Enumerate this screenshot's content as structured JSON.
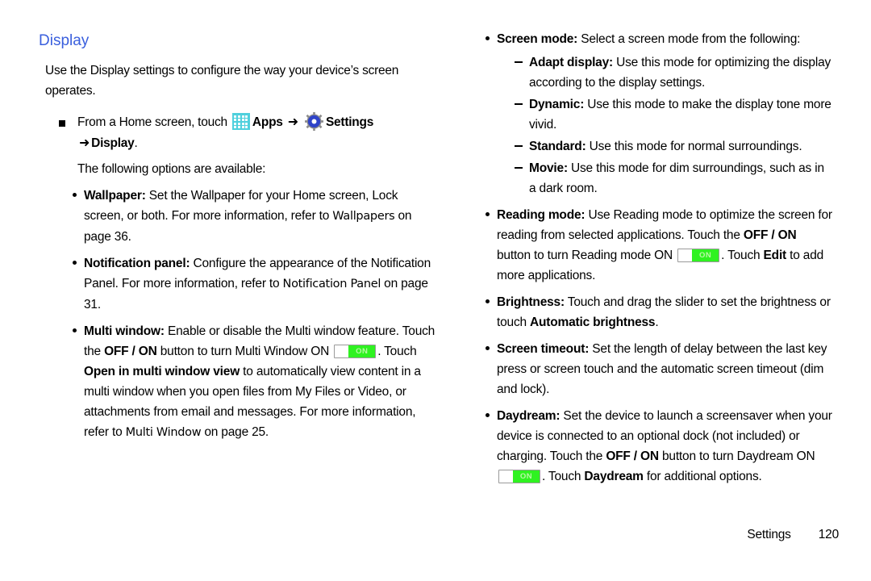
{
  "document": {
    "heading": "Display",
    "intro": "Use the Display settings to configure the way your device’s screen operates."
  },
  "step": {
    "prefix": "From a Home screen, touch",
    "apps_label": "Apps",
    "arrow": "➜",
    "settings_label": "Settings",
    "arrow2": "➜",
    "display_label": "Display",
    "period": ".",
    "following": "The following options are available:",
    "icons": {
      "apps": "apps-grid-icon",
      "settings": "gear-icon"
    }
  },
  "left_column": {
    "bullets": [
      {
        "title": "Wallpaper",
        "colon": ":",
        "body_1": " Set the Wallpaper for your Home screen, Lock screen, or both. For more information, refer to ",
        "xref": "Wallpapers",
        "body_2": " on page 36."
      },
      {
        "title": "Notification panel",
        "colon": ":",
        "body_1": " Configure the appearance of the Notification Panel. For more information, refer to ",
        "xref": "Notification Panel",
        "body_2": " on page 31."
      },
      {
        "title": "Multi window",
        "colon": ":",
        "body_1": " Enable or disable the Multi window feature. Touch the ",
        "bold_1": "OFF / ON",
        "body_2": " button to turn Multi Window ON ",
        "toggle": "ON",
        "body_3": ". Touch ",
        "bold_2": "Open in multi window view",
        "body_4": " to automatically view content in a multi window when you open files from My Files or Video, or attachments from email and messages. For more information, refer to ",
        "xref": "Multi Window",
        "body_5": " on page 25."
      }
    ]
  },
  "right_column": {
    "screen_mode": {
      "title": "Screen mode",
      "colon": ":",
      "body": " Select a screen mode from the following:",
      "options": [
        {
          "title": "Adapt display",
          "colon": ":",
          "body": " Use this mode for optimizing the display according to the display settings."
        },
        {
          "title": "Dynamic",
          "colon": ":",
          "body": " Use this mode to make the display tone more vivid."
        },
        {
          "title": "Standard",
          "colon": ":",
          "body": " Use this mode for normal surroundings."
        },
        {
          "title": "Movie",
          "colon": ":",
          "body": " Use this mode for dim surroundings, such as in a dark room."
        }
      ]
    },
    "reading_mode": {
      "title": "Reading mode",
      "colon": ":",
      "body_1": " Use Reading mode to optimize the screen for reading from selected applications. Touch the ",
      "bold_1": "OFF / ON",
      "body_2": " button to turn Reading mode ON ",
      "toggle": "ON",
      "body_3": ". Touch ",
      "bold_2": "Edit",
      "body_4": " to add more applications."
    },
    "brightness": {
      "title": "Brightness",
      "colon": ":",
      "body_1": " Touch and drag the slider to set the brightness or touch ",
      "bold_1": "Automatic brightness",
      "body_2": "."
    },
    "screen_timeout": {
      "title": "Screen timeout",
      "colon": ":",
      "body": " Set the length of delay between the last key press or screen touch and the automatic screen timeout (dim and lock)."
    },
    "daydream": {
      "title": "Daydream",
      "colon": ":",
      "body_1": " Set the device to launch a screensaver when your device is connected to an optional dock (not included) or charging. Touch the ",
      "bold_1": "OFF / ON",
      "body_2": " button to turn Daydream ON ",
      "toggle": "ON",
      "body_3": ". Touch ",
      "bold_2": "Daydream",
      "body_4": " for additional options."
    }
  },
  "footer": {
    "section": "Settings",
    "page_number": "120"
  },
  "colors": {
    "heading": "#3a5fdd",
    "toggle_on": "#2ff221",
    "toggle_on_text": "#b9f7a6",
    "apps_icon_bg": "#4fd0dd",
    "gear_ring": "#2f43c8",
    "text": "#000000",
    "background": "#ffffff"
  }
}
